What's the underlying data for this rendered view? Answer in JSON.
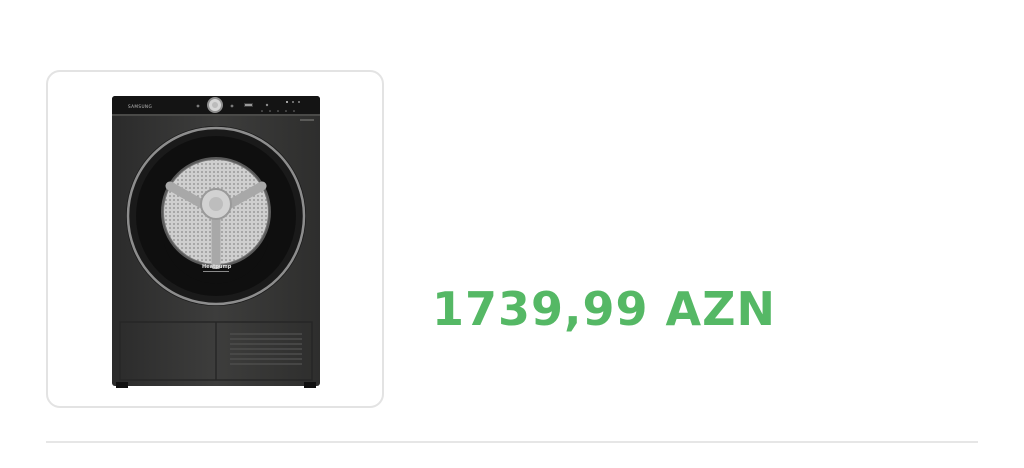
{
  "listing": {
    "image_icon": "tumble-dryer-product-photo",
    "brand_text": "SAMSUNG",
    "door_text": "Heatpump",
    "price": "1739,99 AZN",
    "price_color": "#55b865"
  }
}
